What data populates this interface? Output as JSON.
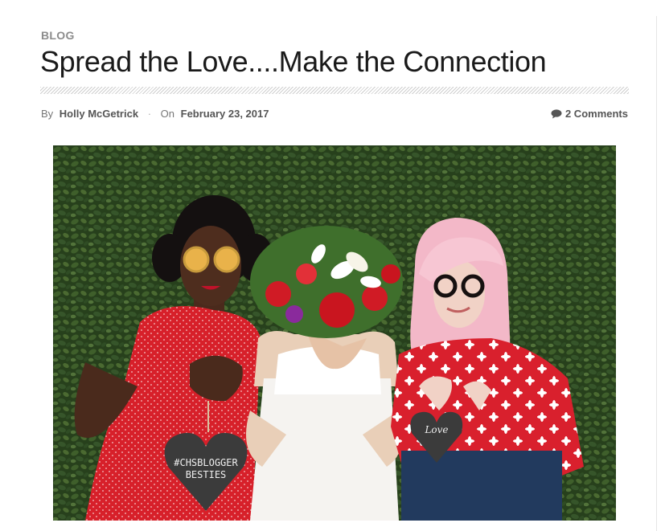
{
  "post": {
    "category": "BLOG",
    "title": "Spread the Love....Make the Connection",
    "by_label": "By",
    "author": "Holly McGetrick",
    "on_label": "On",
    "date": "February 23, 2017",
    "comments": "2 Comments"
  },
  "image": {
    "heart_sign_left": [
      "#CHSBLOGGER",
      "BESTIES"
    ],
    "heart_sign_right": "Love"
  },
  "colors": {
    "category": "#8c8c8c",
    "meta_strong": "#555555",
    "hedge": "#2f4a22",
    "red_dress": "#d8202a",
    "pink_hair": "#f3b8c8",
    "chalkboard": "#3b3b3b"
  }
}
